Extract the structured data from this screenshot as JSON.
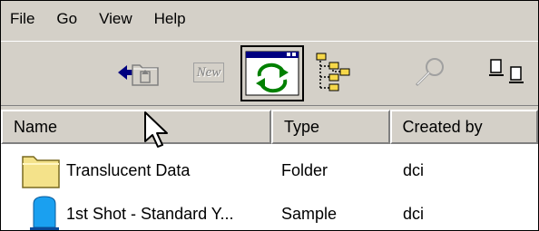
{
  "menu": {
    "items": [
      {
        "label": "File"
      },
      {
        "label": "Go"
      },
      {
        "label": "View"
      },
      {
        "label": "Help"
      }
    ]
  },
  "toolbar": {
    "back_icon": "arrow-left-icon",
    "up_icon": "folder-up-icon",
    "new_label": "New",
    "refresh_icon": "refresh-icon",
    "refresh_selected": true,
    "tree_icon": "tree-view-icon",
    "search_icon": "magnifier-icon",
    "copy_icon": "copy-documents-icon"
  },
  "columns": [
    {
      "label": "Name"
    },
    {
      "label": "Type"
    },
    {
      "label": "Created by"
    }
  ],
  "rows": [
    {
      "name": "Translucent Data",
      "type": "Folder",
      "created_by": "dci",
      "icon": "folder-icon"
    },
    {
      "name": "1st Shot - Standard Y...",
      "type": "Sample",
      "created_by": "dci",
      "icon": "sample-icon"
    }
  ],
  "colors": {
    "chrome": "#d4d0c8",
    "back_arrow": "#000080",
    "refresh_green": "#008000",
    "folder_yellow": "#f4e28a",
    "sample_blue": "#1aa0f0"
  }
}
